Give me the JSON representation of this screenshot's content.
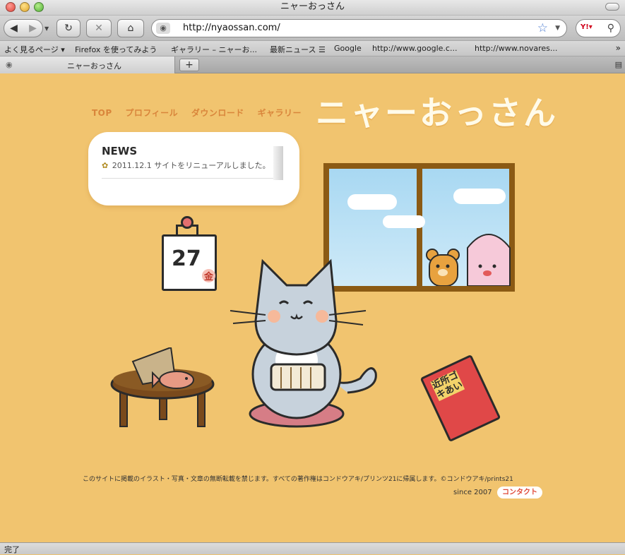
{
  "window": {
    "title": "ニャーおっさん"
  },
  "toolbar": {
    "url": "http://nyaossan.com/"
  },
  "bookmarks": [
    "よく見るページ ▾",
    "Firefox を使ってみよう",
    "ギャラリー – ニャーお...",
    "最新ニュース ☰",
    "Google",
    "http://www.google.c...",
    "http://www.novares..."
  ],
  "tab": {
    "title": "ニャーおっさん",
    "new_tab": "+"
  },
  "page": {
    "nav": [
      "TOP",
      "プロフィール",
      "ダウンロード",
      "ギャラリー"
    ],
    "logo": "ニャーおっさん",
    "news": {
      "title": "NEWS",
      "items": [
        {
          "text": "2011.12.1 サイトをリニューアルしました。"
        }
      ]
    },
    "calendar": {
      "day": "27",
      "weekday": "金"
    },
    "book": {
      "label": "近所ゴキあい"
    },
    "footer": {
      "copyright": "このサイトに掲載のイラスト・写真・文章の無断転載を禁じます。すべての著作権はコンドウアキ/プリンツ21に帰属します。©コンドウアキ/prints21",
      "since": "since 2007",
      "contact": "コンタクト"
    }
  },
  "status": {
    "text": "完了"
  },
  "colors": {
    "page_bg": "#f1c46f",
    "nav": "#d9853b",
    "logo": "#fffbea",
    "window_frame": "#8b5a14",
    "contact_text": "#e04b3a"
  }
}
